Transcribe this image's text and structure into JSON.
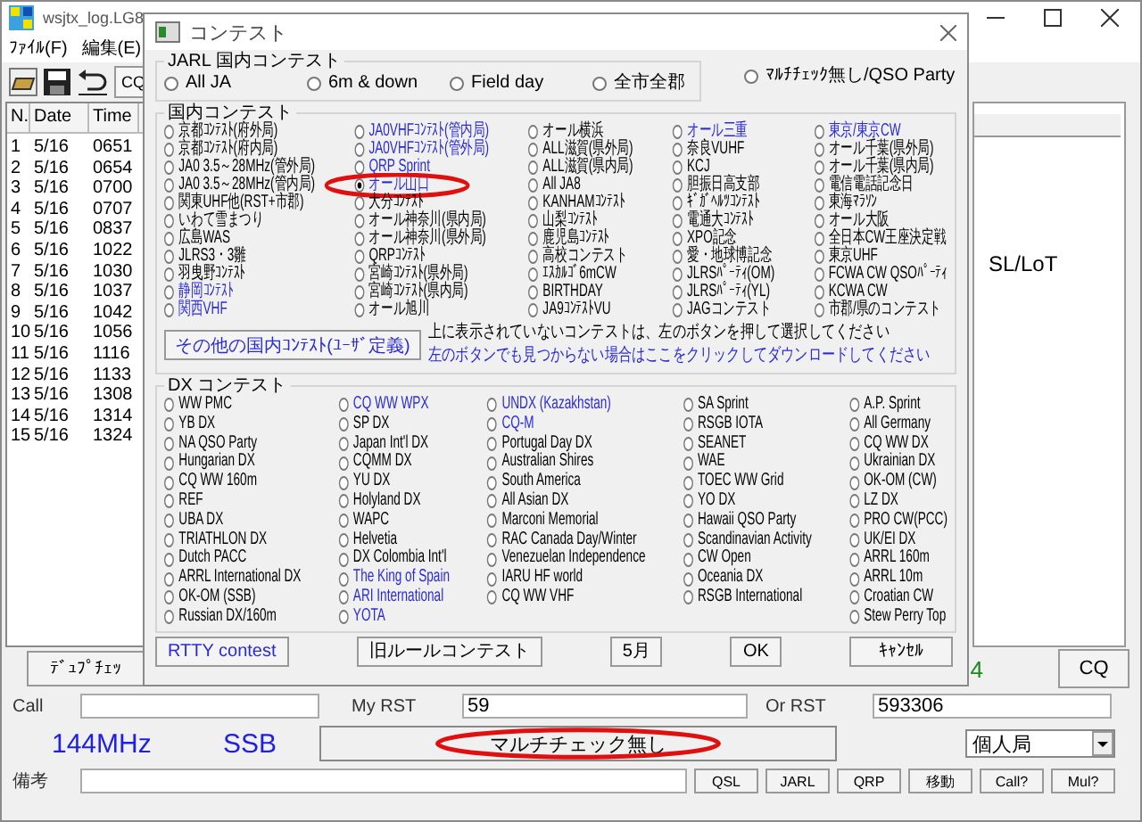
{
  "main_window": {
    "title": "wsjtx_log.LG8",
    "menu": [
      "ﾌｧｲﾙ(F)",
      "編集(E)"
    ],
    "toolbar_button": "CQ",
    "table": {
      "columns": [
        "N.",
        "Date",
        "Time"
      ],
      "rows": [
        [
          "1",
          "5/16",
          "0651"
        ],
        [
          "2",
          "5/16",
          "0654"
        ],
        [
          "3",
          "5/16",
          "0700"
        ],
        [
          "4",
          "5/16",
          "0707"
        ],
        [
          "5",
          "5/16",
          "0837"
        ],
        [
          "6",
          "5/16",
          "1022"
        ],
        [
          "7",
          "5/16",
          "1030"
        ],
        [
          "8",
          "5/16",
          "1037"
        ],
        [
          "9",
          "5/16",
          "1042"
        ],
        [
          "10",
          "5/16",
          "1056"
        ],
        [
          "11",
          "5/16",
          "1116"
        ],
        [
          "12",
          "5/16",
          "1133"
        ],
        [
          "13",
          "5/16",
          "1308"
        ],
        [
          "14",
          "5/16",
          "1314"
        ],
        [
          "15",
          "5/16",
          "1324"
        ]
      ]
    },
    "side_text": "SL/LoT",
    "dupe_check_button": "ﾃﾞｭﾌﾟﾁｪｯ",
    "status_fragment": "4",
    "cq_button": "CQ",
    "call_label": "Call",
    "my_rst_label": "My RST",
    "my_rst": "59",
    "or_rst_label": "Or RST",
    "or_rst": "593306",
    "band": "144MHz",
    "mode": "SSB",
    "multi_check_button": {
      "label": "マルチチェック無し",
      "circled": true
    },
    "station_type": "個人局",
    "remarks_label": "備考",
    "buttons": [
      "QSL",
      "JARL",
      "QRP",
      "移動",
      "Call?",
      "Mul?"
    ]
  },
  "dialog": {
    "title": "コンテスト",
    "jarl": {
      "title": "JARL 国内コンテスト",
      "options": [
        {
          "label": "All JA",
          "selected": false
        },
        {
          "label": "6m & down",
          "selected": false
        },
        {
          "label": "Field day",
          "selected": false
        },
        {
          "label": "全市全郡",
          "selected": false
        }
      ]
    },
    "no_multi_option": {
      "label": "ﾏﾙﾁﾁｪｯｸ無し/QSO Party",
      "selected": false
    },
    "domestic": {
      "title": "国内コンテスト",
      "columns": [
        {
          "items": [
            {
              "label": "京都ｺﾝﾃｽﾄ(府外局)",
              "selected": false,
              "highlighted": false,
              "circled": false
            },
            {
              "label": "京都ｺﾝﾃｽﾄ(府内局)",
              "selected": false,
              "highlighted": false,
              "circled": false
            },
            {
              "label": "JA0 3.5～28MHz(管外局)",
              "selected": false,
              "highlighted": false,
              "circled": false
            },
            {
              "label": "JA0 3.5～28MHz(管内局)",
              "selected": false,
              "highlighted": false,
              "circled": false
            },
            {
              "label": "関東UHF他(RST+市郡)",
              "selected": false,
              "highlighted": false,
              "circled": false
            },
            {
              "label": "いわて雪まつり",
              "selected": false,
              "highlighted": false,
              "circled": false
            },
            {
              "label": "広島WAS",
              "selected": false,
              "highlighted": false,
              "circled": false
            },
            {
              "label": "JLRS3・3雛",
              "selected": false,
              "highlighted": false,
              "circled": false
            },
            {
              "label": "羽曳野ｺﾝﾃｽﾄ",
              "selected": false,
              "highlighted": false,
              "circled": false
            },
            {
              "label": "静岡ｺﾝﾃｽﾄ",
              "selected": false,
              "highlighted": true,
              "circled": false
            },
            {
              "label": "関西VHF",
              "selected": false,
              "highlighted": true,
              "circled": false
            }
          ]
        },
        {
          "items": [
            {
              "label": "JA0VHFｺﾝﾃｽﾄ(管内局)",
              "selected": false,
              "highlighted": true,
              "circled": false
            },
            {
              "label": "JA0VHFｺﾝﾃｽﾄ(管外局)",
              "selected": false,
              "highlighted": true,
              "circled": false
            },
            {
              "label": "QRP Sprint",
              "selected": false,
              "highlighted": true,
              "circled": false
            },
            {
              "label": "オール山口",
              "selected": true,
              "highlighted": true,
              "circled": true
            },
            {
              "label": "大分ｺﾝﾃｽﾄ",
              "selected": false,
              "highlighted": false,
              "circled": false
            },
            {
              "label": "オール神奈川(県内局)",
              "selected": false,
              "highlighted": false,
              "circled": false
            },
            {
              "label": "オール神奈川(県外局)",
              "selected": false,
              "highlighted": false,
              "circled": false
            },
            {
              "label": "QRPｺﾝﾃｽﾄ",
              "selected": false,
              "highlighted": false,
              "circled": false
            },
            {
              "label": "宮崎ｺﾝﾃｽﾄ(県外局)",
              "selected": false,
              "highlighted": false,
              "circled": false
            },
            {
              "label": "宮崎ｺﾝﾃｽﾄ(県内局)",
              "selected": false,
              "highlighted": false,
              "circled": false
            },
            {
              "label": "オール旭川",
              "selected": false,
              "highlighted": false,
              "circled": false
            }
          ]
        },
        {
          "items": [
            {
              "label": "オール横浜",
              "selected": false,
              "highlighted": false,
              "circled": false
            },
            {
              "label": "ALL滋賀(県外局)",
              "selected": false,
              "highlighted": false,
              "circled": false
            },
            {
              "label": "ALL滋賀(県内局)",
              "selected": false,
              "highlighted": false,
              "circled": false
            },
            {
              "label": "All JA8",
              "selected": false,
              "highlighted": false,
              "circled": false
            },
            {
              "label": "KANHAMｺﾝﾃｽﾄ",
              "selected": false,
              "highlighted": false,
              "circled": false
            },
            {
              "label": "山梨ｺﾝﾃｽﾄ",
              "selected": false,
              "highlighted": false,
              "circled": false
            },
            {
              "label": "鹿児島ｺﾝﾃｽﾄ",
              "selected": false,
              "highlighted": false,
              "circled": false
            },
            {
              "label": "高校コンテスト",
              "selected": false,
              "highlighted": false,
              "circled": false
            },
            {
              "label": "ｴｽｶﾙｺﾞ6mCW",
              "selected": false,
              "highlighted": false,
              "circled": false
            },
            {
              "label": "BIRTHDAY",
              "selected": false,
              "highlighted": false,
              "circled": false
            },
            {
              "label": "JA9ｺﾝﾃｽﾄVU",
              "selected": false,
              "highlighted": false,
              "circled": false
            }
          ]
        },
        {
          "items": [
            {
              "label": "オール三重",
              "selected": false,
              "highlighted": true,
              "circled": false
            },
            {
              "label": "奈良VUHF",
              "selected": false,
              "highlighted": false,
              "circled": false
            },
            {
              "label": "KCJ",
              "selected": false,
              "highlighted": false,
              "circled": false
            },
            {
              "label": "胆振日高支部",
              "selected": false,
              "highlighted": false,
              "circled": false
            },
            {
              "label": "ｷﾞｶﾞﾍﾙﾂｺﾝﾃｽﾄ",
              "selected": false,
              "highlighted": false,
              "circled": false
            },
            {
              "label": "電通大ｺﾝﾃｽﾄ",
              "selected": false,
              "highlighted": false,
              "circled": false
            },
            {
              "label": "XPO記念",
              "selected": false,
              "highlighted": false,
              "circled": false
            },
            {
              "label": "愛・地球博記念",
              "selected": false,
              "highlighted": false,
              "circled": false
            },
            {
              "label": "JLRSﾊﾟｰﾃｨ(OM)",
              "selected": false,
              "highlighted": false,
              "circled": false
            },
            {
              "label": "JLRSﾊﾟｰﾃｨ(YL)",
              "selected": false,
              "highlighted": false,
              "circled": false
            },
            {
              "label": "JAGコンテスト",
              "selected": false,
              "highlighted": false,
              "circled": false
            }
          ]
        },
        {
          "items": [
            {
              "label": "東京/東京CW",
              "selected": false,
              "highlighted": true,
              "circled": false
            },
            {
              "label": "オール千葉(県外局)",
              "selected": false,
              "highlighted": false,
              "circled": false
            },
            {
              "label": "オール千葉(県内局)",
              "selected": false,
              "highlighted": false,
              "circled": false
            },
            {
              "label": "電信電話記念日",
              "selected": false,
              "highlighted": false,
              "circled": false
            },
            {
              "label": "東海ﾏﾗｿﾝ",
              "selected": false,
              "highlighted": false,
              "circled": false
            },
            {
              "label": "オール大阪",
              "selected": false,
              "highlighted": false,
              "circled": false
            },
            {
              "label": "全日本CW王座決定戦",
              "selected": false,
              "highlighted": false,
              "circled": false
            },
            {
              "label": "東京UHF",
              "selected": false,
              "highlighted": false,
              "circled": false
            },
            {
              "label": "FCWA CW QSOﾊﾟｰﾃｨ",
              "selected": false,
              "highlighted": false,
              "circled": false
            },
            {
              "label": "KCWA CW",
              "selected": false,
              "highlighted": false,
              "circled": false
            },
            {
              "label": "市郡/県のコンテスト",
              "selected": false,
              "highlighted": false,
              "circled": false
            }
          ]
        }
      ],
      "user_defined_button": "その他の国内ｺﾝﾃｽﾄ(ﾕｰｻﾞ定義)",
      "hint": "上に表示されていないコンテストは、左のボタンを押して選択してください",
      "download_link": "左のボタンでも見つからない場合はここをクリックしてダウンロードしてください"
    },
    "dx": {
      "title": "DX コンテスト",
      "columns": [
        {
          "items": [
            {
              "label": "WW PMC",
              "selected": false,
              "highlighted": false
            },
            {
              "label": "YB DX",
              "selected": false,
              "highlighted": false
            },
            {
              "label": "NA QSO Party",
              "selected": false,
              "highlighted": false
            },
            {
              "label": "Hungarian DX",
              "selected": false,
              "highlighted": false
            },
            {
              "label": "CQ WW 160m",
              "selected": false,
              "highlighted": false
            },
            {
              "label": "REF",
              "selected": false,
              "highlighted": false
            },
            {
              "label": "UBA DX",
              "selected": false,
              "highlighted": false
            },
            {
              "label": "TRIATHLON DX",
              "selected": false,
              "highlighted": false
            },
            {
              "label": "Dutch PACC",
              "selected": false,
              "highlighted": false
            },
            {
              "label": "ARRL International DX",
              "selected": false,
              "highlighted": false
            },
            {
              "label": "OK-OM (SSB)",
              "selected": false,
              "highlighted": false
            },
            {
              "label": "Russian DX/160m",
              "selected": false,
              "highlighted": false
            }
          ]
        },
        {
          "items": [
            {
              "label": "CQ WW WPX",
              "selected": false,
              "highlighted": true
            },
            {
              "label": "SP DX",
              "selected": false,
              "highlighted": false
            },
            {
              "label": "Japan Int'l DX",
              "selected": false,
              "highlighted": false
            },
            {
              "label": "CQMM DX",
              "selected": false,
              "highlighted": false
            },
            {
              "label": "YU DX",
              "selected": false,
              "highlighted": false
            },
            {
              "label": "Holyland DX",
              "selected": false,
              "highlighted": false
            },
            {
              "label": "WAPC",
              "selected": false,
              "highlighted": false
            },
            {
              "label": "Helvetia",
              "selected": false,
              "highlighted": false
            },
            {
              "label": "DX Colombia Int'l",
              "selected": false,
              "highlighted": false
            },
            {
              "label": "The King of Spain",
              "selected": false,
              "highlighted": true
            },
            {
              "label": "ARI International",
              "selected": false,
              "highlighted": true
            },
            {
              "label": "YOTA",
              "selected": false,
              "highlighted": true
            }
          ]
        },
        {
          "items": [
            {
              "label": "UNDX (Kazakhstan)",
              "selected": false,
              "highlighted": true
            },
            {
              "label": "CQ-M",
              "selected": false,
              "highlighted": true
            },
            {
              "label": "Portugal Day DX",
              "selected": false,
              "highlighted": false
            },
            {
              "label": "Australian Shires",
              "selected": false,
              "highlighted": false
            },
            {
              "label": "South America",
              "selected": false,
              "highlighted": false
            },
            {
              "label": "All Asian DX",
              "selected": false,
              "highlighted": false
            },
            {
              "label": "Marconi Memorial",
              "selected": false,
              "highlighted": false
            },
            {
              "label": "RAC Canada Day/Winter",
              "selected": false,
              "highlighted": false
            },
            {
              "label": "Venezuelan Independence",
              "selected": false,
              "highlighted": false
            },
            {
              "label": "IARU HF world",
              "selected": false,
              "highlighted": false
            },
            {
              "label": "CQ WW VHF",
              "selected": false,
              "highlighted": false
            }
          ]
        },
        {
          "items": [
            {
              "label": "SA Sprint",
              "selected": false,
              "highlighted": false
            },
            {
              "label": "RSGB IOTA",
              "selected": false,
              "highlighted": false
            },
            {
              "label": "SEANET",
              "selected": false,
              "highlighted": false
            },
            {
              "label": "WAE",
              "selected": false,
              "highlighted": false
            },
            {
              "label": "TOEC WW Grid",
              "selected": false,
              "highlighted": false
            },
            {
              "label": "YO DX",
              "selected": false,
              "highlighted": false
            },
            {
              "label": "Hawaii QSO Party",
              "selected": false,
              "highlighted": false
            },
            {
              "label": "Scandinavian Activity",
              "selected": false,
              "highlighted": false
            },
            {
              "label": "CW Open",
              "selected": false,
              "highlighted": false
            },
            {
              "label": "Oceania DX",
              "selected": false,
              "highlighted": false
            },
            {
              "label": "RSGB International",
              "selected": false,
              "highlighted": false
            }
          ]
        },
        {
          "items": [
            {
              "label": "A.P. Sprint",
              "selected": false,
              "highlighted": false
            },
            {
              "label": "All Germany",
              "selected": false,
              "highlighted": false
            },
            {
              "label": "CQ WW DX",
              "selected": false,
              "highlighted": false
            },
            {
              "label": "Ukrainian DX",
              "selected": false,
              "highlighted": false
            },
            {
              "label": "OK-OM (CW)",
              "selected": false,
              "highlighted": false
            },
            {
              "label": "LZ DX",
              "selected": false,
              "highlighted": false
            },
            {
              "label": "PRO CW(PCC)",
              "selected": false,
              "highlighted": false
            },
            {
              "label": "UK/EI DX",
              "selected": false,
              "highlighted": false
            },
            {
              "label": "ARRL 160m",
              "selected": false,
              "highlighted": false
            },
            {
              "label": "ARRL 10m",
              "selected": false,
              "highlighted": false
            },
            {
              "label": "Croatian CW",
              "selected": false,
              "highlighted": false
            },
            {
              "label": "Stew Perry Top",
              "selected": false,
              "highlighted": false
            }
          ]
        }
      ]
    },
    "buttons": [
      {
        "label": "RTTY contest",
        "highlighted": true
      },
      {
        "label": "旧ルールコンテスト",
        "highlighted": false
      },
      {
        "label": "5月",
        "highlighted": false
      },
      {
        "label": "OK",
        "highlighted": false
      },
      {
        "label": "ｷｬﾝｾﾙ",
        "highlighted": false
      }
    ]
  }
}
